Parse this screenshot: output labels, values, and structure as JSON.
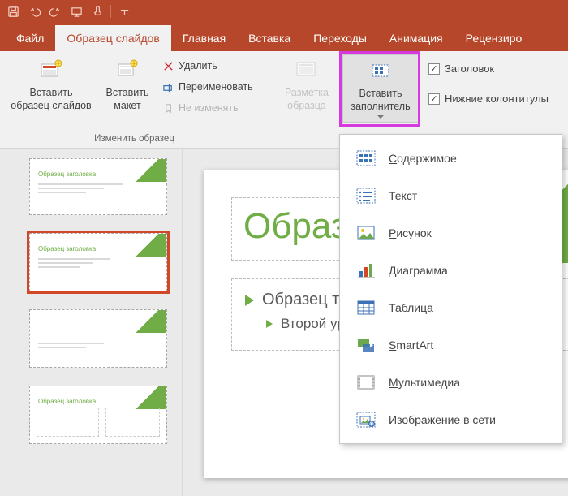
{
  "qat": {
    "save": "save",
    "undo": "undo",
    "redo": "redo",
    "slideshow": "slideshow",
    "touch": "touch"
  },
  "tabs": {
    "file": "Файл",
    "slideMaster": "Образец слайдов",
    "home": "Главная",
    "insert": "Вставка",
    "transitions": "Переходы",
    "animations": "Анимация",
    "review": "Рецензиро"
  },
  "ribbon": {
    "group_edit_label": "Изменить образец",
    "insert_master": "Вставить\nобразец слайдов",
    "insert_layout": "Вставить\nмакет",
    "delete": "Удалить",
    "rename": "Переименовать",
    "preserve": "Не изменять",
    "master_layout": "Разметка\nобразца",
    "insert_placeholder": "Вставить\nзаполнитель",
    "chk_title": "Заголовок",
    "chk_footers": "Нижние колонтитулы"
  },
  "dropdown": {
    "content": "Содержимое",
    "text": "Текст",
    "picture": "Рисунок",
    "chart": "Диаграмма",
    "table": "Таблица",
    "smartart": "SmartArt",
    "media": "Мультимедиа",
    "online_image": "Изображение в сети"
  },
  "slide": {
    "title": "Образец заголо",
    "bullet1": "Образец текста",
    "bullet2": "Второй уровень"
  },
  "thumb": {
    "title": "Образец заголовка"
  }
}
